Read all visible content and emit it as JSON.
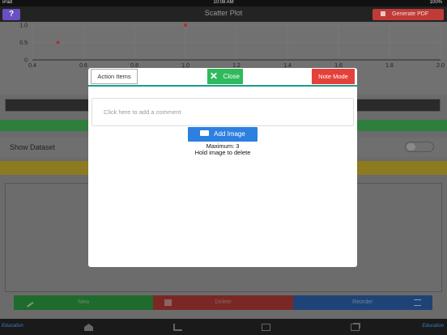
{
  "status": {
    "carrier": "iPad",
    "time": "10:08 AM",
    "battery": "100%"
  },
  "nav": {
    "help_label": "?",
    "title": "Scatter Plot",
    "pdf_label": "Generate PDF"
  },
  "chart_data": {
    "type": "scatter",
    "x_ticks": [
      "0.4",
      "0.6",
      "0.8",
      "1.0",
      "1.2",
      "1.4",
      "1.6",
      "1.8",
      "2.0"
    ],
    "y_ticks": [
      "0",
      "0.5",
      "1.0"
    ],
    "xlim": [
      0.4,
      2.0
    ],
    "ylim": [
      0,
      1.0
    ],
    "grid": true,
    "point_color": "#b03030",
    "points": [
      {
        "x": 0.5,
        "y": 0.5
      },
      {
        "x": 1.0,
        "y": 1.0
      }
    ]
  },
  "dataset": {
    "label": "Show Dataset",
    "enabled": false
  },
  "actions": {
    "new_label": "New",
    "delete_label": "Delete",
    "reorder_label": "Reorder"
  },
  "tabs": [
    "home-icon",
    "chart-icon",
    "checkbox-icon",
    "copy-icon"
  ],
  "modal": {
    "action_items_label": "Action Items",
    "close_label": "Close",
    "note_mode_label": "Note Mode",
    "comment_placeholder": "Click here to add a comment",
    "add_image_label": "Add Image",
    "maximum_text": "Maximum: 3",
    "hold_text": "Hold image to delete",
    "accent": "#1a9e8a"
  }
}
